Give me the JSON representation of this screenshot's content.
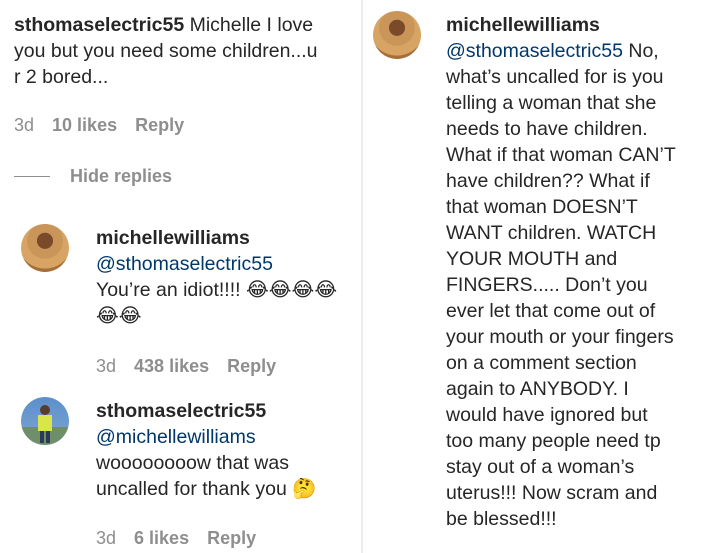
{
  "left": {
    "top_comment": {
      "username": "sthomaselectric55",
      "line1_rest": " Michelle I love",
      "line2": "you but you need some children...u",
      "line3": "r 2 bored...",
      "time": "3d",
      "likes": "10 likes",
      "reply": "Reply"
    },
    "hide_replies": "Hide replies",
    "reply1": {
      "username": "michellewilliams",
      "mention": "@sthomaselectric55",
      "text": "You’re an idiot!!!! 😂😂😂😂",
      "text2": "😂😂",
      "time": "3d",
      "likes": "438 likes",
      "reply": "Reply"
    },
    "reply2": {
      "username": "sthomaselectric55",
      "mention": "@michellewilliams",
      "line1": "woooooooow that was",
      "line2": "uncalled for thank you 🤔",
      "time": "3d",
      "likes": "6 likes",
      "reply": "Reply"
    }
  },
  "right": {
    "username": "michellewilliams",
    "lines": [
      "@sthomaselectric55 No,",
      "what’s uncalled for is you",
      "telling a woman that she",
      "needs to have children.",
      "What if that woman CAN’T",
      "have children?? What if",
      "that woman DOESN’T",
      "WANT children. WATCH",
      "YOUR MOUTH and",
      "FINGERS..... Don’t you",
      "ever let that come out of",
      "your mouth or your fingers",
      "on a comment section",
      "again to ANYBODY. I",
      "would have ignored but",
      "too many people need tp",
      "stay out of a woman’s",
      "uterus!!! Now scram and",
      "be blessed!!!"
    ],
    "mention_in_first_line": "@sthomaselectric55",
    "first_line_rest": " No,"
  }
}
